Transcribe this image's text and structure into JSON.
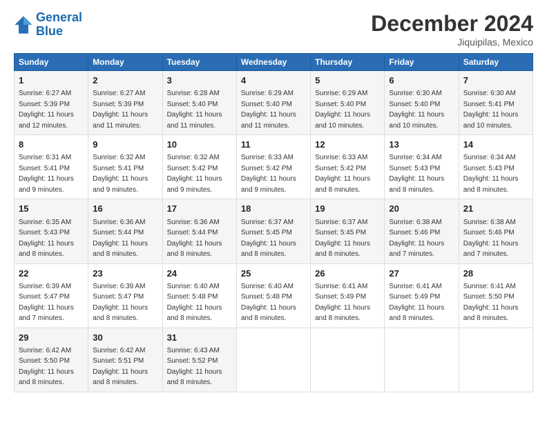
{
  "header": {
    "logo_line1": "General",
    "logo_line2": "Blue",
    "month": "December 2024",
    "location": "Jiquipilas, Mexico"
  },
  "days_of_week": [
    "Sunday",
    "Monday",
    "Tuesday",
    "Wednesday",
    "Thursday",
    "Friday",
    "Saturday"
  ],
  "weeks": [
    [
      {
        "day": "1",
        "info": "Sunrise: 6:27 AM\nSunset: 5:39 PM\nDaylight: 11 hours\nand 12 minutes."
      },
      {
        "day": "2",
        "info": "Sunrise: 6:27 AM\nSunset: 5:39 PM\nDaylight: 11 hours\nand 11 minutes."
      },
      {
        "day": "3",
        "info": "Sunrise: 6:28 AM\nSunset: 5:40 PM\nDaylight: 11 hours\nand 11 minutes."
      },
      {
        "day": "4",
        "info": "Sunrise: 6:29 AM\nSunset: 5:40 PM\nDaylight: 11 hours\nand 11 minutes."
      },
      {
        "day": "5",
        "info": "Sunrise: 6:29 AM\nSunset: 5:40 PM\nDaylight: 11 hours\nand 10 minutes."
      },
      {
        "day": "6",
        "info": "Sunrise: 6:30 AM\nSunset: 5:40 PM\nDaylight: 11 hours\nand 10 minutes."
      },
      {
        "day": "7",
        "info": "Sunrise: 6:30 AM\nSunset: 5:41 PM\nDaylight: 11 hours\nand 10 minutes."
      }
    ],
    [
      {
        "day": "8",
        "info": "Sunrise: 6:31 AM\nSunset: 5:41 PM\nDaylight: 11 hours\nand 9 minutes."
      },
      {
        "day": "9",
        "info": "Sunrise: 6:32 AM\nSunset: 5:41 PM\nDaylight: 11 hours\nand 9 minutes."
      },
      {
        "day": "10",
        "info": "Sunrise: 6:32 AM\nSunset: 5:42 PM\nDaylight: 11 hours\nand 9 minutes."
      },
      {
        "day": "11",
        "info": "Sunrise: 6:33 AM\nSunset: 5:42 PM\nDaylight: 11 hours\nand 9 minutes."
      },
      {
        "day": "12",
        "info": "Sunrise: 6:33 AM\nSunset: 5:42 PM\nDaylight: 11 hours\nand 8 minutes."
      },
      {
        "day": "13",
        "info": "Sunrise: 6:34 AM\nSunset: 5:43 PM\nDaylight: 11 hours\nand 8 minutes."
      },
      {
        "day": "14",
        "info": "Sunrise: 6:34 AM\nSunset: 5:43 PM\nDaylight: 11 hours\nand 8 minutes."
      }
    ],
    [
      {
        "day": "15",
        "info": "Sunrise: 6:35 AM\nSunset: 5:43 PM\nDaylight: 11 hours\nand 8 minutes."
      },
      {
        "day": "16",
        "info": "Sunrise: 6:36 AM\nSunset: 5:44 PM\nDaylight: 11 hours\nand 8 minutes."
      },
      {
        "day": "17",
        "info": "Sunrise: 6:36 AM\nSunset: 5:44 PM\nDaylight: 11 hours\nand 8 minutes."
      },
      {
        "day": "18",
        "info": "Sunrise: 6:37 AM\nSunset: 5:45 PM\nDaylight: 11 hours\nand 8 minutes."
      },
      {
        "day": "19",
        "info": "Sunrise: 6:37 AM\nSunset: 5:45 PM\nDaylight: 11 hours\nand 8 minutes."
      },
      {
        "day": "20",
        "info": "Sunrise: 6:38 AM\nSunset: 5:46 PM\nDaylight: 11 hours\nand 7 minutes."
      },
      {
        "day": "21",
        "info": "Sunrise: 6:38 AM\nSunset: 5:46 PM\nDaylight: 11 hours\nand 7 minutes."
      }
    ],
    [
      {
        "day": "22",
        "info": "Sunrise: 6:39 AM\nSunset: 5:47 PM\nDaylight: 11 hours\nand 7 minutes."
      },
      {
        "day": "23",
        "info": "Sunrise: 6:39 AM\nSunset: 5:47 PM\nDaylight: 11 hours\nand 8 minutes."
      },
      {
        "day": "24",
        "info": "Sunrise: 6:40 AM\nSunset: 5:48 PM\nDaylight: 11 hours\nand 8 minutes."
      },
      {
        "day": "25",
        "info": "Sunrise: 6:40 AM\nSunset: 5:48 PM\nDaylight: 11 hours\nand 8 minutes."
      },
      {
        "day": "26",
        "info": "Sunrise: 6:41 AM\nSunset: 5:49 PM\nDaylight: 11 hours\nand 8 minutes."
      },
      {
        "day": "27",
        "info": "Sunrise: 6:41 AM\nSunset: 5:49 PM\nDaylight: 11 hours\nand 8 minutes."
      },
      {
        "day": "28",
        "info": "Sunrise: 6:41 AM\nSunset: 5:50 PM\nDaylight: 11 hours\nand 8 minutes."
      }
    ],
    [
      {
        "day": "29",
        "info": "Sunrise: 6:42 AM\nSunset: 5:50 PM\nDaylight: 11 hours\nand 8 minutes."
      },
      {
        "day": "30",
        "info": "Sunrise: 6:42 AM\nSunset: 5:51 PM\nDaylight: 11 hours\nand 8 minutes."
      },
      {
        "day": "31",
        "info": "Sunrise: 6:43 AM\nSunset: 5:52 PM\nDaylight: 11 hours\nand 8 minutes."
      },
      null,
      null,
      null,
      null
    ]
  ]
}
